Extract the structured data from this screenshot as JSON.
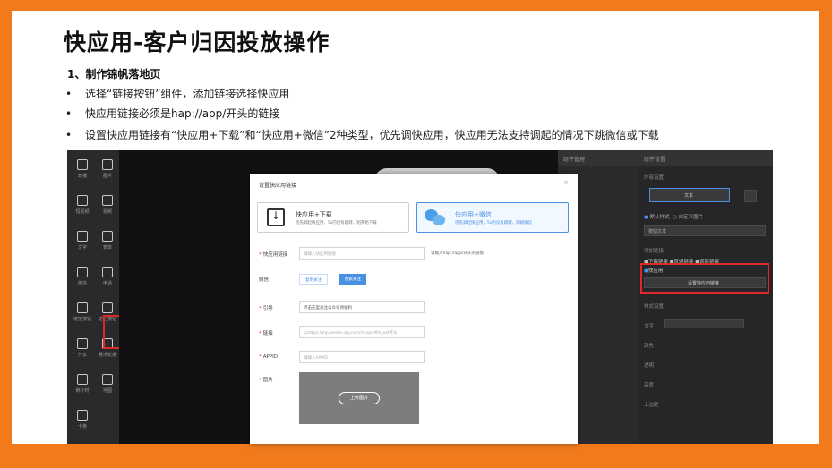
{
  "slide": {
    "title": "快应用-客户归因投放操作",
    "subheading": "1、制作锦帆落地页",
    "bullets": [
      "选择“链接按钮”组件，添加链接选择快应用",
      "快应用链接必须是hap://app/开头的链接",
      "设置快应用链接有“快应用+下载”和“快应用+微信”2种类型，优先调快应用，快应用无法支持调起的情况下跳微信或下载"
    ],
    "bullet_symbol": "•"
  },
  "colors": {
    "frame_orange": "#f07a1c",
    "highlight_red": "#e12828",
    "accent_blue": "#4a90e2"
  },
  "editor": {
    "left_tools": [
      {
        "label": "轮播",
        "icon": "carousel-icon"
      },
      {
        "label": "图片",
        "icon": "image-icon"
      },
      {
        "label": "短视频",
        "icon": "video-icon"
      },
      {
        "label": "视频",
        "icon": "video-play-icon"
      },
      {
        "label": "文字",
        "icon": "text-icon"
      },
      {
        "label": "表单",
        "icon": "form-icon"
      },
      {
        "label": "微信",
        "icon": "wechat-icon"
      },
      {
        "label": "电话",
        "icon": "phone-icon"
      },
      {
        "label": "链接按钮",
        "icon": "link-button-icon"
      },
      {
        "label": "返回按钮",
        "icon": "back-button-icon"
      },
      {
        "label": "分享",
        "icon": "share-icon"
      },
      {
        "label": "悬浮轮播",
        "icon": "float-carousel-icon"
      },
      {
        "label": "倒计时",
        "icon": "countdown-icon"
      },
      {
        "label": "地图",
        "icon": "map-icon"
      },
      {
        "label": "卡券",
        "icon": "coupon-icon"
      }
    ],
    "mid_panel_header": "组件管理",
    "right_panel": {
      "header": "组件设置",
      "content_settings": "内容设置",
      "text_button": "文本",
      "style_default": "默认样式",
      "style_custom": "自定义图片",
      "button_text": "按钮文本",
      "add_link": "添加链接",
      "link_options": [
        "下载链接",
        "普通链接",
        "调链链接"
      ],
      "quickapp_option": "快应用",
      "set_quickapp_button": "设置快应用链接",
      "style_settings": "样式设置",
      "text_label": "文字",
      "color_label": "颜色",
      "opacity_label": "透明",
      "height_label": "高度",
      "margin_label": "上边距"
    }
  },
  "modal": {
    "title": "设置快应用链接",
    "close": "×",
    "option1": {
      "title": "快应用+下载",
      "desc": "优先调起快应用，5s内没有跳转，则开始下载"
    },
    "option2": {
      "title": "快应用+微信",
      "desc": "优先调起快应用，5s内没有跳转，则跳微信"
    },
    "fields": {
      "quickapp_link_label": "快应用链接",
      "quickapp_link_placeholder": "请输入快应用链接",
      "quickapp_link_hint": "请输入hap://app/开头的链接",
      "wechat_label": "微信",
      "wechat_seg1": "复制关注",
      "wechat_seg2": "搜索关注",
      "guide_label": "引导",
      "guide_value": "点击这里关注公众号领福利",
      "link_label": "链接",
      "link_placeholder": "以https://mp.weixin.qq.com/mp/profile_ext开头",
      "appid_label": "APPID",
      "appid_placeholder": "请输入APPID",
      "image_label": "图片",
      "upload_button": "上传图片"
    }
  }
}
